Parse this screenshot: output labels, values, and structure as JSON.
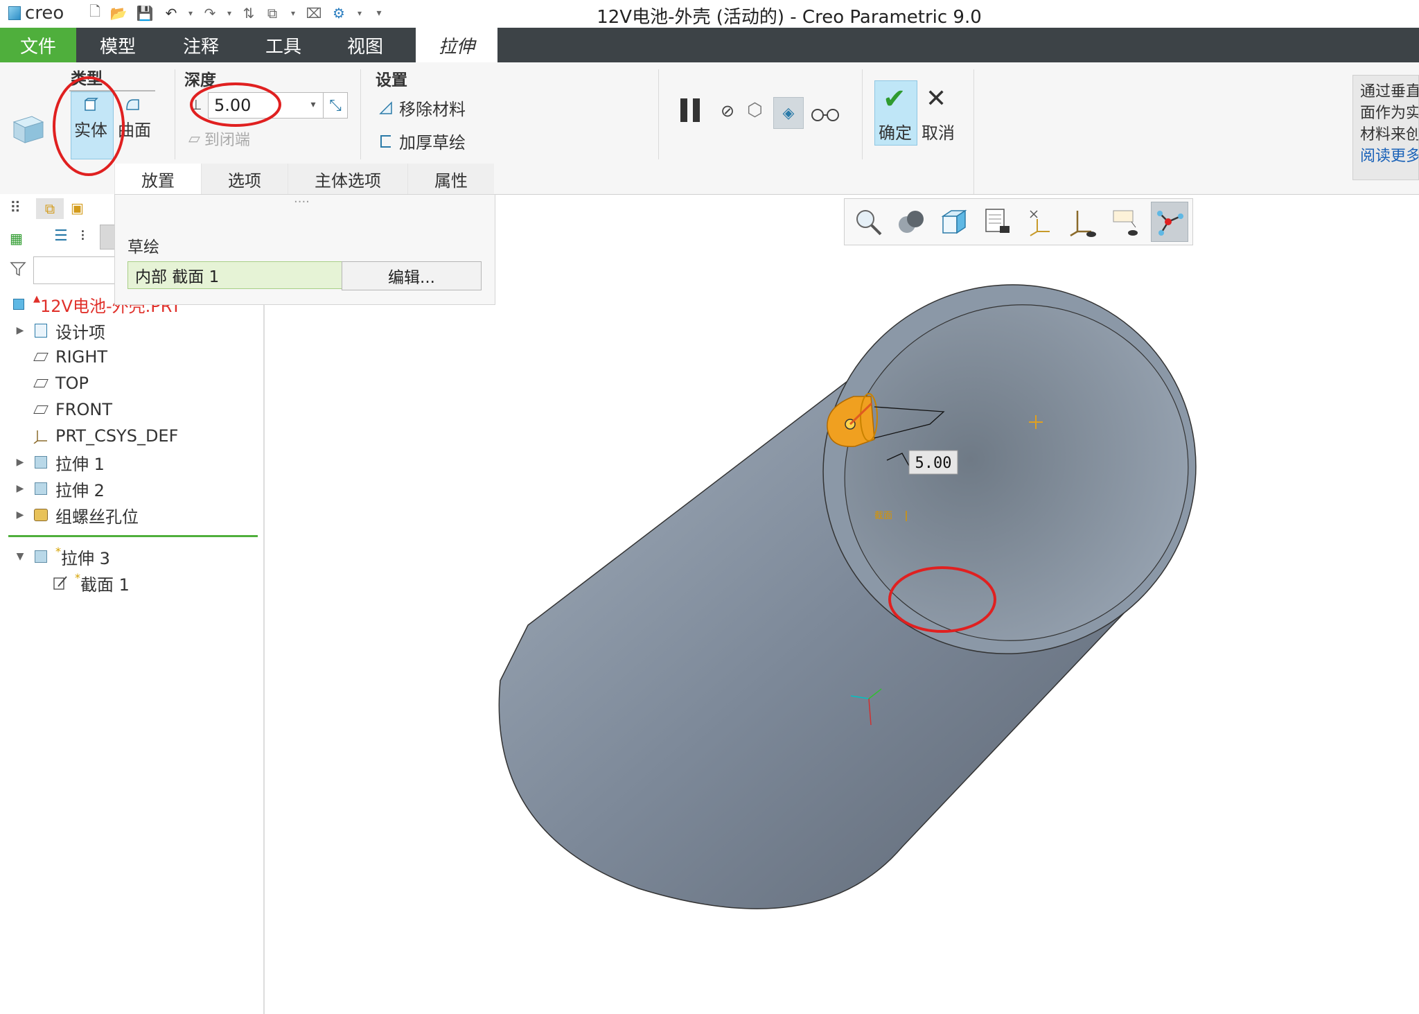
{
  "window": {
    "app_logo": "creo",
    "title": "12V电池-外壳 (活动的) - Creo Parametric 9.0"
  },
  "ribbon_tabs": [
    "文件",
    "模型",
    "注释",
    "工具",
    "视图",
    "拉伸"
  ],
  "ribbon": {
    "type_group": {
      "title": "类型",
      "solid": "实体",
      "surface": "曲面"
    },
    "depth_group": {
      "title": "深度",
      "value": "5.00",
      "to_closed": "到闭端"
    },
    "settings_group": {
      "title": "设置",
      "remove_material": "移除材料",
      "thicken_sketch": "加厚草绘"
    },
    "confirm": "确定",
    "cancel": "取消",
    "subtabs": [
      "放置",
      "选项",
      "主体选项",
      "属性"
    ]
  },
  "placement_panel": {
    "handle": "····",
    "sketch_label": "草绘",
    "section_value": "内部 截面 1",
    "edit_button": "编辑..."
  },
  "model_tree": {
    "root": "12V电池-外壳.PRT",
    "items": [
      {
        "label": "设计项"
      },
      {
        "label": "RIGHT"
      },
      {
        "label": "TOP"
      },
      {
        "label": "FRONT"
      },
      {
        "label": "PRT_CSYS_DEF"
      },
      {
        "label": "拉伸 1"
      },
      {
        "label": "拉伸 2"
      },
      {
        "label": "组螺丝孔位"
      },
      {
        "label": "拉伸 3"
      },
      {
        "label": "截面 1"
      }
    ],
    "new_marker": "*"
  },
  "viewport": {
    "dimension_label": "5.00",
    "section_tag": "截面"
  },
  "tooltip": {
    "lines": [
      "通过垂直",
      "面作为实",
      "材料来创"
    ],
    "link": "阅读更多"
  },
  "colors": {
    "file_tab": "#4faf3c",
    "tab_bar": "#3d4347",
    "annotation_red": "#e02020",
    "feature_orange": "#f0a020",
    "model_gray": "#8a96a6",
    "confirm_bg": "#bfe6f7"
  }
}
